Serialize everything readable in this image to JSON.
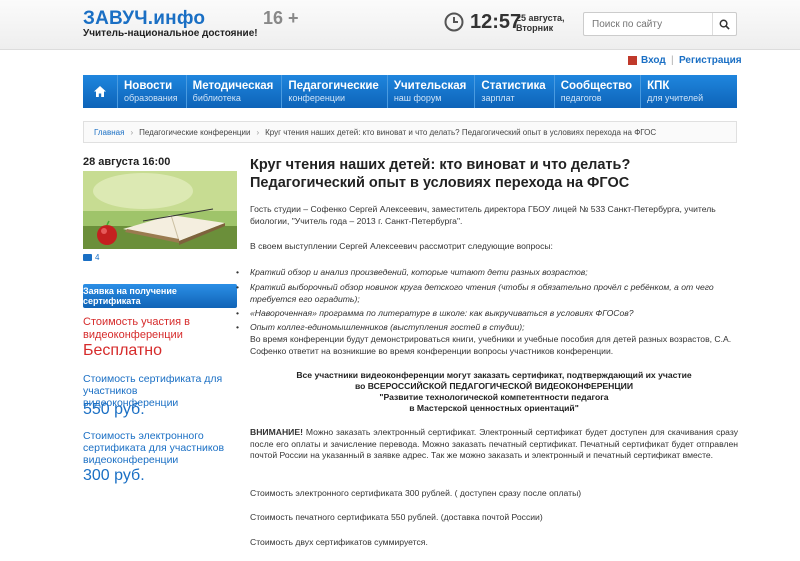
{
  "header": {
    "logo": "ЗАВУЧ.инфо",
    "slogan": "Учитель-национальное достояние!",
    "age": "16 +",
    "time": "12:57",
    "date_line1": "25 августа,",
    "date_line2": "Вторник",
    "search_placeholder": "Поиск по сайту"
  },
  "auth": {
    "login": "Вход",
    "separator": "|",
    "register": "Регистрация"
  },
  "nav": [
    {
      "title": "Новости",
      "sub": "образования"
    },
    {
      "title": "Методическая",
      "sub": "библиотека"
    },
    {
      "title": "Педагогические",
      "sub": "конференции"
    },
    {
      "title": "Учительская",
      "sub": "наш форум"
    },
    {
      "title": "Статистика",
      "sub": "зарплат"
    },
    {
      "title": "Сообщество",
      "sub": "педагогов"
    },
    {
      "title": "КПК",
      "sub": "для учителей"
    }
  ],
  "breadcrumbs": {
    "home": "Главная",
    "section": "Педагогические конференции",
    "current": "Круг чтения наших детей: кто виноват и что делать? Педагогический опыт в условиях перехода на ФГОС"
  },
  "sidebar": {
    "date": "28 августа 16:00",
    "comments": "4",
    "cert_button": "Заявка на получение сертификата",
    "price_free_label": "Стоимость участия в видеоконференции",
    "price_free": "Бесплатно",
    "price_cert_label": "Стоимость сертификата для участников видеоконференции",
    "price_cert": "550 руб.",
    "price_ecert_label": "Стоимость электронного сертификата для участников видеоконференции",
    "price_ecert": "300 руб."
  },
  "article": {
    "title": "Круг чтения наших детей: кто виноват и что делать? Педагогический опыт в условиях перехода на ФГОС",
    "guest": "Гость студии – Софенко Сергей Алексеевич, заместитель директора ГБОУ лицей № 533 Санкт-Петербурга, учитель биологии, \"Учитель года – 2013 г. Санкт-Петербурга\".",
    "intro": "В своем выступлении Сергей Алексеевич рассмотрит следующие вопросы:",
    "bullets": [
      "Краткий обзор и анализ произведений, которые читают дети разных возрастов;",
      "Краткий выборочный обзор новинок круга детского чтения (чтобы я обязательно прочёл с ребёнком, а от чего требуется его оградить);",
      "«Навороченная» программа по литературе в школе: как выкручиваться в условиях ФГОСов?",
      "Опыт коллег-единомышленников (выступления гостей в студии);"
    ],
    "books_note": "Во время конференции будут демонстрироваться книги, учебники и учебные пособия для детей разных возрастов, С.А. Софенко ответит на возникшие во время конференции вопросы участников конференции.",
    "center_lines": [
      "Все участники видеоконференции могут заказать сертификат, подтверждающий их участие",
      "во ВСЕРОССИЙСКОЙ ПЕДАГОГИЧЕСКОЙ ВИДЕОКОНФЕРЕНЦИИ",
      "\"Развитие технологической компетентности педагога",
      "в Мастерской ценностных ориентаций\""
    ],
    "attention_label": "ВНИМАНИЕ!",
    "attention_text": " Можно заказать электронный сертификат. Электронный сертификат будет доступен для скачивания сразу после его оплаты и зачисление перевода. Можно заказать печатный сертификат. Печатный сертификат будет отправлен почтой России на указанный в заявке адрес. Так же можно заказать и электронный и печатный сертификат вместе.",
    "price_e": "Стоимость электронного сертификата 300 рублей. ( доступен сразу после оплаты)",
    "price_p": "Стоимость печатного сертификата 550 рублей. (доставка почтой России)",
    "price_sum": "Стоимость двух сертификатов суммируется."
  },
  "colors": {
    "brand_blue": "#1a6fc4",
    "nav_blue": "#1478d2",
    "accent_red": "#d62b2b"
  }
}
